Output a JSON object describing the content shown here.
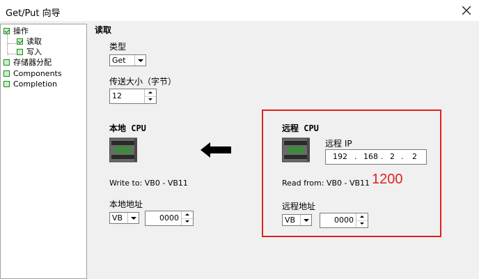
{
  "window": {
    "title": "Get/Put 向导"
  },
  "tree": {
    "items": [
      {
        "label": "操作",
        "checked": true
      },
      {
        "label": "读取",
        "checked": true
      },
      {
        "label": "写入",
        "checked": false
      },
      {
        "label": "存储器分配",
        "checked": false
      },
      {
        "label": "Components",
        "checked": false
      },
      {
        "label": "Completion",
        "checked": false
      }
    ]
  },
  "main": {
    "section_title": "读取",
    "type_label": "类型",
    "type_value": "Get",
    "size_label": "传送大小（字节）",
    "size_value": "12",
    "local": {
      "title": "本地 CPU",
      "write_to": "Write to: VB0 - VB11",
      "addr_label": "本地地址",
      "area_value": "VB",
      "offset_value": "0000"
    },
    "remote": {
      "title": "远程 CPU",
      "ip_label": "远程 IP",
      "ip": [
        "192",
        "168",
        "2",
        "2"
      ],
      "ip_sep": ".",
      "read_from": "Read from: VB0 - VB11",
      "addr_label": "远程地址",
      "area_value": "VB",
      "offset_value": "0000",
      "annotation": "1200"
    }
  },
  "colors": {
    "annotation": "#e02020",
    "tree_check": "#1a8a1a"
  },
  "icons": [
    "close-icon",
    "plc-cpu-icon",
    "arrow-left-icon",
    "checkbox-icon"
  ]
}
